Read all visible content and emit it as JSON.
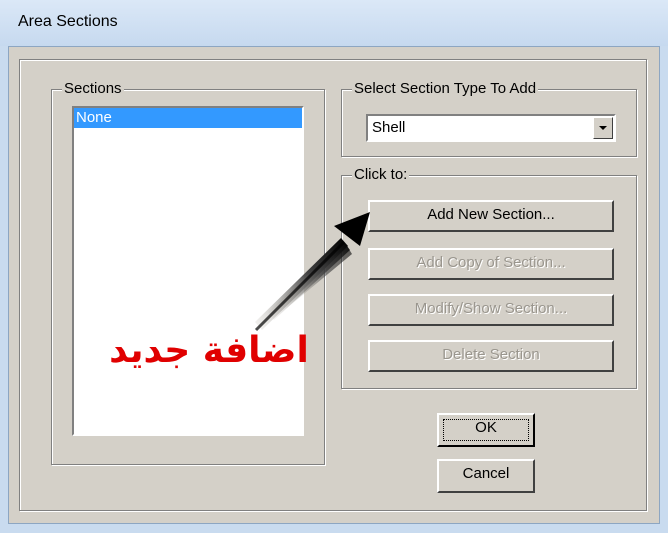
{
  "window": {
    "title": "Area Sections"
  },
  "sections_group": {
    "legend": "Sections",
    "items": [
      {
        "label": "None",
        "selected": true
      }
    ]
  },
  "type_group": {
    "legend": "Select Section Type To Add",
    "selected_type": "Shell"
  },
  "click_group": {
    "legend": "Click to:",
    "add_new": "Add New Section...",
    "add_copy": "Add Copy of Section...",
    "modify_show": "Modify/Show Section...",
    "delete": "Delete Section"
  },
  "buttons": {
    "ok": "OK",
    "cancel": "Cancel"
  },
  "annotation": {
    "text": "اضافة جديد",
    "color": "#e00000"
  },
  "colors": {
    "selection": "#3399ff",
    "dialog_face": "#d4d0c8"
  }
}
